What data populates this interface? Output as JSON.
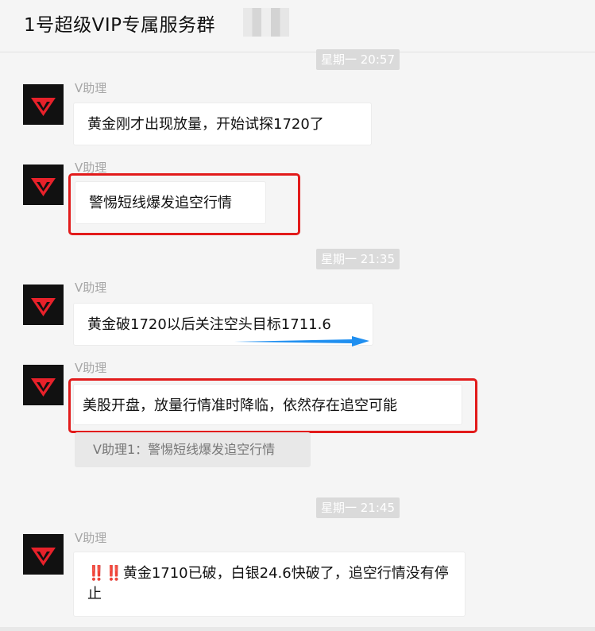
{
  "header": {
    "title": "1号超级VIP专属服务群"
  },
  "messages": [
    {
      "time": "星期一 20:57",
      "sender": "V助理",
      "text": "黄金刚才出现放量，开始试探1720了"
    },
    {
      "sender": "V助理",
      "text": "警惕短线爆发追空行情"
    },
    {
      "time": "星期一 21:35",
      "sender": "V助理",
      "text": "黄金破1720以后关注空头目标1711.6"
    },
    {
      "sender": "V助理",
      "text": "美股开盘，放量行情准时降临，依然存在追空可能",
      "quote": "V助理1：警惕短线爆发追空行情"
    },
    {
      "time": "星期一 21:45",
      "sender": "V助理",
      "prefix": "‼️‼️",
      "text": "黄金1710已破，白银24.6快破了，追空行情没有停止"
    }
  ],
  "colors": {
    "highlight": "#e21b1b",
    "arrow": "#1f8ff0",
    "avatar_bg": "#111111",
    "avatar_mark": "#e8212a"
  },
  "icons": {
    "avatar": "v-logo-icon",
    "arrow": "right-arrow-icon"
  }
}
